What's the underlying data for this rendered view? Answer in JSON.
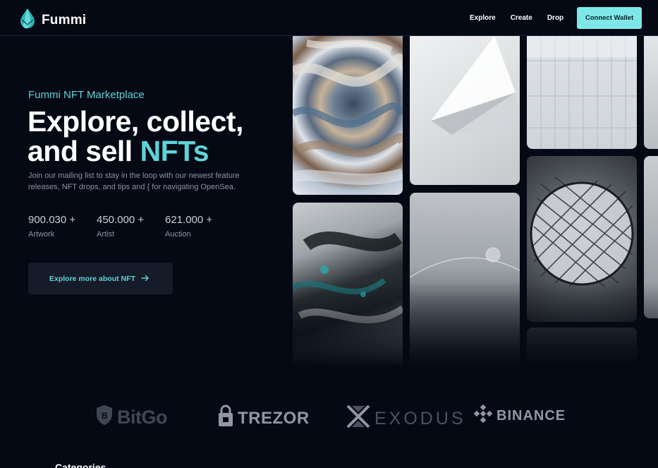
{
  "nav": {
    "brand": "Fummi",
    "links": [
      "Explore",
      "Create",
      "Drop"
    ],
    "connect_label": "Connect Wallet"
  },
  "hero": {
    "eyebrow": "Fummi NFT Marketplace",
    "title_line1": "Explore, collect,",
    "title_line2_prefix": "and sell ",
    "title_line2_accent": "NFTs",
    "description": "Join our mailing list to stay in the loop with our newest feature releases, NFT drops, and tips and { for navigating OpenSea.",
    "stats": [
      {
        "value": "900.030 +",
        "label": "Artwork"
      },
      {
        "value": "450.000 +",
        "label": "Artist"
      },
      {
        "value": "621.000 +",
        "label": "Auction"
      }
    ],
    "cta_label": "Explore more about NFT",
    "cta_icon": "arrow-right-icon"
  },
  "gallery": {
    "cards": [
      "abstract-swirl",
      "white-folded-paper",
      "white-building",
      "dark-marble-fluid",
      "glass-sphere-floor",
      "lattice-sphere",
      "white-partial"
    ]
  },
  "partners": [
    "BitGo",
    "TREZOR",
    "EXODUS",
    "BINANCE"
  ],
  "sections": {
    "categories_title": "Categories"
  },
  "colors": {
    "accent": "#5fd3d9",
    "button": "#7ee8e8",
    "background": "#050914"
  }
}
